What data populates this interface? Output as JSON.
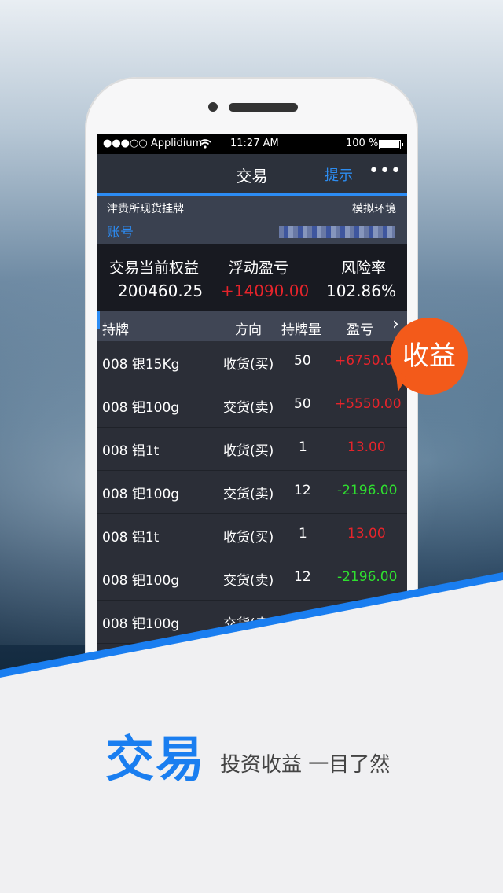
{
  "status_bar": {
    "carrier": "●●●○○ Applidium",
    "wifi": "wifi-icon",
    "time": "11:27 AM",
    "battery_pct": "100 %"
  },
  "nav": {
    "title": "交易",
    "hint": "提示",
    "more": "•••"
  },
  "account": {
    "exchange": "津贵所现货挂牌",
    "env": "模拟环境",
    "account_label": "账号"
  },
  "summary": {
    "equity_label": "交易当前权益",
    "equity_value": "200460.25",
    "pnl_label": "浮动盈亏",
    "pnl_value": "+14090.00",
    "risk_label": "风险率",
    "risk_value": "102.86%"
  },
  "table": {
    "headers": {
      "holding": "持牌",
      "direction": "方向",
      "qty": "持牌量",
      "pnl": "盈亏",
      "next": "›"
    },
    "rows": [
      {
        "name": "008 银15Kg",
        "dir": "收货(买)",
        "qty": "50",
        "pnl": "+6750.00",
        "color": "red"
      },
      {
        "name": "008 钯100g",
        "dir": "交货(卖)",
        "qty": "50",
        "pnl": "+5550.00",
        "color": "red"
      },
      {
        "name": "008 铝1t",
        "dir": "收货(买)",
        "qty": "1",
        "pnl": "13.00",
        "color": "red"
      },
      {
        "name": "008 钯100g",
        "dir": "交货(卖)",
        "qty": "12",
        "pnl": "-2196.00",
        "color": "green"
      },
      {
        "name": "008 铝1t",
        "dir": "收货(买)",
        "qty": "1",
        "pnl": "13.00",
        "color": "red"
      },
      {
        "name": "008 钯100g",
        "dir": "交货(卖)",
        "qty": "12",
        "pnl": "-2196.00",
        "color": "green"
      },
      {
        "name": "008 钯100g",
        "dir": "交货(卖)",
        "qty": "",
        "pnl": "",
        "color": "red"
      }
    ]
  },
  "badge": "收益",
  "caption": {
    "main": "交易",
    "sub": "投资收益 一目了然"
  },
  "colors": {
    "accent": "#2c8cf4",
    "badge": "#f35a1a",
    "loss": "#2fe02f",
    "gain": "#e6242b"
  }
}
